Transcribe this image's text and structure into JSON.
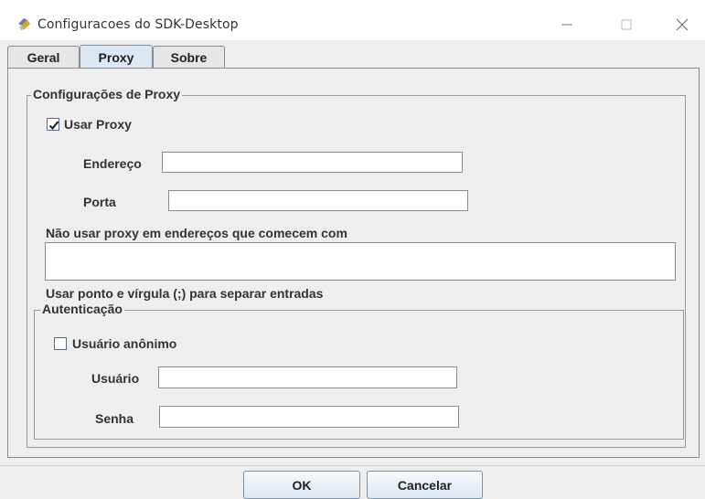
{
  "window": {
    "title": "Configuracoes do SDK-Desktop",
    "icon": "sdk-tool-icon",
    "controls": [
      "minimize-icon",
      "maximize-icon",
      "close-icon"
    ]
  },
  "tabs": [
    {
      "label": "Geral",
      "active": false
    },
    {
      "label": "Proxy",
      "active": true
    },
    {
      "label": "Sobre",
      "active": false
    }
  ],
  "proxy_group": {
    "legend": "Configurações de Proxy",
    "use_proxy": {
      "label": "Usar Proxy",
      "checked": true
    },
    "address": {
      "label": "Endereço",
      "value": ""
    },
    "port": {
      "label": "Porta",
      "value": ""
    },
    "bypass": {
      "label": "Não usar proxy em endereços que comecem com",
      "value": ""
    },
    "hint": "Usar ponto e vírgula (;) para separar entradas"
  },
  "auth_group": {
    "legend": "Autenticação",
    "anonymous": {
      "label": "Usuário anônimo",
      "checked": false
    },
    "user": {
      "label": "Usuário",
      "value": ""
    },
    "password": {
      "label": "Senha",
      "value": ""
    }
  },
  "buttons": {
    "ok": "OK",
    "cancel": "Cancelar"
  },
  "colors": {
    "window_bg": "#eeeeee",
    "active_tab": "#dce8f4",
    "border": "#8a8a8a"
  }
}
